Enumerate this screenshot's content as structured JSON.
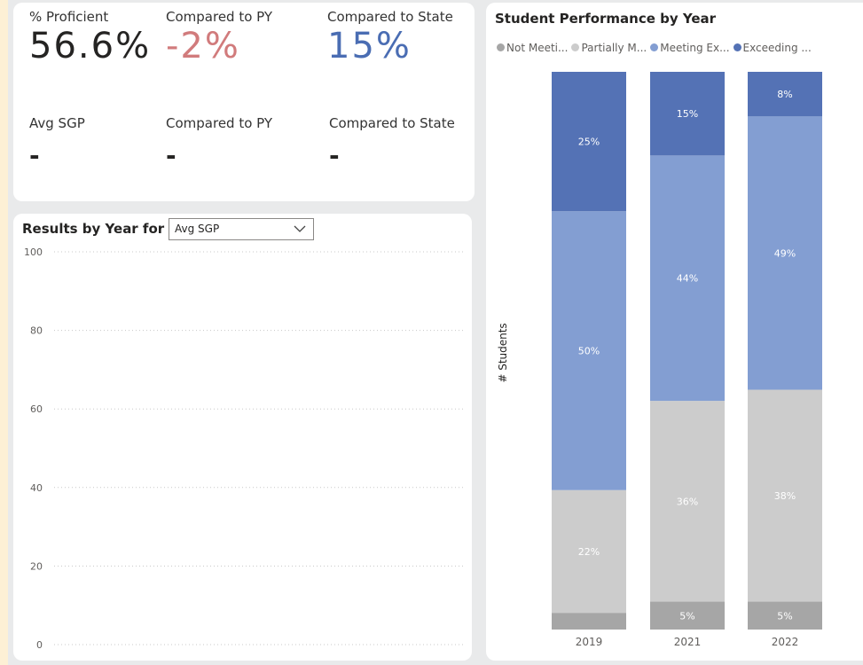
{
  "kpis": {
    "row1": [
      {
        "label": "% Proficient",
        "value": "56.6%",
        "color": "#252423"
      },
      {
        "label": "Compared to PY",
        "value": "-2%",
        "color": "#d17b7c"
      },
      {
        "label": "Compared to State",
        "value": "15%",
        "color": "#4a6db3"
      }
    ],
    "row2": [
      {
        "label": "Avg SGP",
        "value": "-"
      },
      {
        "label": "Compared to PY",
        "value": "-"
      },
      {
        "label": "Compared to State",
        "value": "-"
      }
    ]
  },
  "results": {
    "title": "Results by Year for",
    "dropdown_value": "Avg SGP",
    "y_ticks": [
      "100",
      "80",
      "60",
      "40",
      "20",
      "0"
    ]
  },
  "chart_data": {
    "type": "bar",
    "title": "Student Performance by Year",
    "ylabel": "# Students",
    "categories": [
      "2019",
      "2021",
      "2022"
    ],
    "legend": [
      {
        "name": "Not Meeti...",
        "color": "#a6a6a6"
      },
      {
        "name": "Partially M...",
        "color": "#cccccc"
      },
      {
        "name": "Meeting Ex...",
        "color": "#839ed2"
      },
      {
        "name": "Exceeding ...",
        "color": "#5472b5"
      }
    ],
    "series": [
      {
        "name": "Not Meeting",
        "values": [
          3,
          5,
          5
        ],
        "labels": [
          "",
          "5%",
          "5%"
        ],
        "color": "#a6a6a6"
      },
      {
        "name": "Partially Meeting",
        "values": [
          22,
          36,
          38
        ],
        "labels": [
          "22%",
          "36%",
          "38%"
        ],
        "color": "#cccccc"
      },
      {
        "name": "Meeting Expectations",
        "values": [
          50,
          44,
          49
        ],
        "labels": [
          "50%",
          "44%",
          "49%"
        ],
        "color": "#839ed2"
      },
      {
        "name": "Exceeding Expectations",
        "values": [
          25,
          15,
          8
        ],
        "labels": [
          "25%",
          "15%",
          "8%"
        ],
        "color": "#5472b5"
      }
    ]
  }
}
